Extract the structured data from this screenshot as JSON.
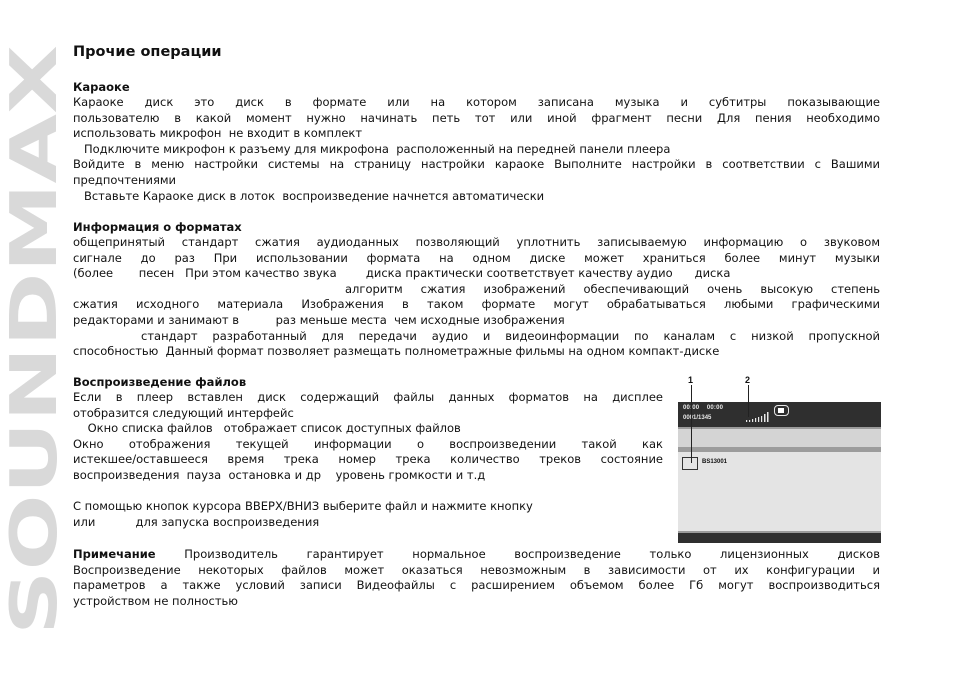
{
  "brand": {
    "watermark": "SOUNDMAX",
    "watermark_color": "#d9d9d9"
  },
  "page": {
    "title": "Прочие операции",
    "sections": {
      "karaoke": {
        "heading": "Караоке",
        "lines": [
          "   Караоке диск    это диск в формате           или           на котором записана музыка и субтитры  показывающие",
          "пользователю  в какой  момент  нужно  начинать  петь  тот  или  иной  фрагмент  песни   Для  пения  необходимо",
          "использовать микрофон  не входит в комплект",
          "   Подключите микрофон к разъему для микрофона  расположенный на передней панели плеера",
          "   Войдите в меню настройки системы на страницу настройки караоке  Выполните настройки в соответствии с Вашими",
          "предпочтениями",
          "   Вставьте Караоке диск в лоток  воспроизведение начнется автоматически"
        ]
      },
      "formats": {
        "heading": "Информация о форматах",
        "lines": [
          "         общепринятый стандарт сжатия аудиоданных  позволяющий уплотнить записываемую информацию о звуковом",
          "сигнале до     раз  При использовании формата        на одном      диске может храниться более        минут музыки",
          "(более       песен   При этом качество звука        диска практически соответствует качеству аудио      диска",
          "                                                                   алгоритм  сжатия  изображений  обеспечивающий  очень  высокую  степень",
          "сжатия  исходного  материала   Изображения  в  таком  формате  могут  обрабатываться  любыми  графическими",
          "редакторами и занимают в          раз меньше места  чем исходные изображения",
          "              стандарт  разработанный  для  передачи  аудио   и  видеоинформации  по  каналам  с  низкой  пропускной",
          "способностью  Данный формат позволяет размещать полнометражные фильмы на одном компакт-диске"
        ]
      },
      "playback": {
        "heading": "Воспроизведение файлов",
        "lines": [
          "Если  в  плеер  вставлен  диск   содержащий  файлы  данных  форматов   на  дисплее",
          "отобразится следующий интерфейс",
          "    Окно списка файлов   отображает список доступных файлов",
          "          Окно   отображения   текущей   информации   о   воспроизведении    такой   как",
          "истекшее/оставшееся   время   трека    номер   трека    количество   треков    состояние",
          "воспроизведения  пауза  остановка и др    уровень громкости и т.д",
          "",
          "С помощью кнопок курсора ВВЕРХ/ВНИЗ выберите файл и нажмите кнопку",
          "или           для запуска воспроизведения"
        ]
      },
      "note": {
        "label": "Примечание",
        "lines": [
          "   Производитель    гарантирует    нормальное    воспроизведение    только    лицензионных    дисков",
          "Воспроизведение  некоторых        файлов  может  оказаться  невозможным  в  зависимости  от  их  конфигурации  и",
          "параметров  а также условий записи  Видеофайлы с расширением       объемом более    Гб могут воспроизводиться",
          "устройством не полностью"
        ]
      }
    }
  },
  "screen_illustration": {
    "callouts": [
      "1",
      "2"
    ],
    "elapsed_time": "00:00",
    "total_time": "00:00",
    "track_counter": "0001/1345",
    "volume_level_bars": 8,
    "playback_state_icon": "stop-icon",
    "file_name": "BS13001",
    "file_icon": "file-icon",
    "colors": {
      "bar_dark": "#2f2f2f",
      "panel_light": "#e4e4e4",
      "separator": "#9c9c9c"
    }
  }
}
